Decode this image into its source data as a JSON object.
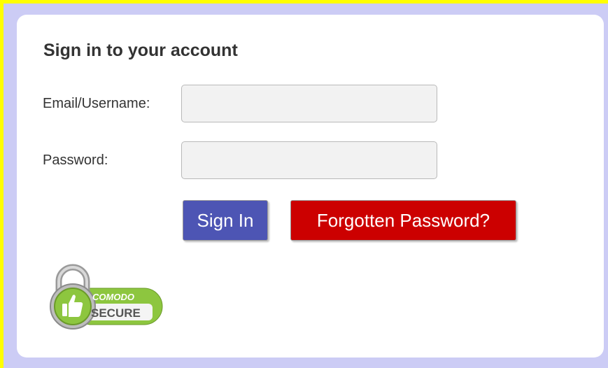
{
  "form": {
    "title": "Sign in to your account",
    "email_label": "Email/Username:",
    "email_value": "",
    "password_label": "Password:",
    "password_value": ""
  },
  "buttons": {
    "signin_label": "Sign In",
    "forgot_label": "Forgotten Password?"
  },
  "badge": {
    "line1": "COMODO",
    "line2": "SECURE",
    "icon": "thumbs-up-padlock-icon"
  },
  "colors": {
    "page_bg": "#ccccf5",
    "frame": "#ffff00",
    "signin_button": "#4d55b4",
    "forgot_button": "#cc0000",
    "badge_green": "#8dc63f"
  }
}
